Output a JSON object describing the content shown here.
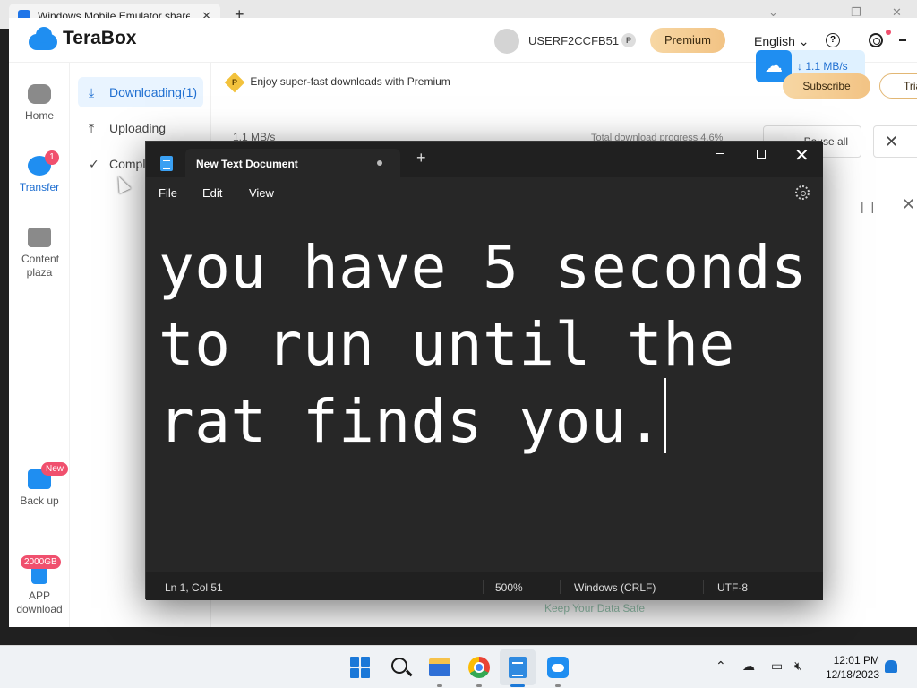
{
  "browser": {
    "tab_title": "Windows Mobile Emulator share",
    "close_glyph": "✕",
    "new_tab_glyph": "+"
  },
  "terabox": {
    "brand": "TeraBox",
    "user": {
      "name": "USERF2CCFB51",
      "badge": "P"
    },
    "premium_label": "Premium",
    "language": "English ⌄",
    "help_glyph": "?",
    "speed_indicator": "↓ 1.1 MB/s",
    "nav": [
      {
        "label": "Home",
        "icon": "cloud-icon"
      },
      {
        "label": "Transfer",
        "icon": "transfer-icon",
        "badge": "1"
      },
      {
        "label": "Content plaza",
        "icon": "play-icon"
      },
      {
        "label": "Back up",
        "icon": "backup-icon",
        "badge": "New"
      },
      {
        "label": "APP download",
        "icon": "phone-icon",
        "badge": "2000GB"
      }
    ],
    "subnav": [
      {
        "label": "Downloading(1)",
        "icon": "download-icon"
      },
      {
        "label": "Uploading",
        "icon": "upload-icon"
      },
      {
        "label": "Compl",
        "icon": "check-circle-icon"
      }
    ],
    "banner_text": "Enjoy super-fast downloads with Premium",
    "banner_badge": "P",
    "subscribe_label": "Subscribe",
    "trial_label": "Tria",
    "speed_ghost": "1.1 MB/s",
    "progress_ghost": "Total download progress 4.6%",
    "pause_all_label": "Pause all",
    "close_glyph": "✕",
    "row_pause_glyph": "| |",
    "keep_safe": "Keep Your Data Safe"
  },
  "notepad": {
    "tab_title": "New Text Document",
    "new_tab_glyph": "+",
    "close_glyph": "✕",
    "menu": [
      "File",
      "Edit",
      "View"
    ],
    "content": "you have 5 seconds to run until the rat finds you.",
    "status": {
      "position": "Ln 1, Col 51",
      "zoom": "500%",
      "line_ending": "Windows (CRLF)",
      "encoding": "UTF-8"
    }
  },
  "taskbar": {
    "chevron": "⌃",
    "time": "12:01 PM",
    "date": "12/18/2023"
  },
  "colors": {
    "terabox_blue": "#1f8ef1",
    "accent_red": "#f0506e",
    "notepad_bg": "#272727",
    "premium_gold": "#f2c384"
  }
}
